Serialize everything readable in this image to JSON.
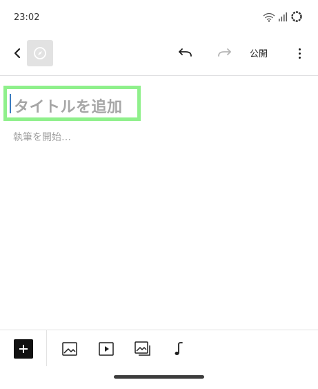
{
  "status_bar": {
    "time": "23:02",
    "icons": [
      "wifi-icon",
      "signal-icon",
      "battery-ring-icon"
    ]
  },
  "toolbar": {
    "back_icon": "chevron-left-icon",
    "site_icon": "compass-icon",
    "undo_icon": "undo-icon",
    "redo_icon": "redo-icon",
    "publish_label": "公開",
    "more_icon": "more-vertical-icon"
  },
  "editor": {
    "title_placeholder": "タイトルを追加",
    "body_placeholder": "執筆を開始…"
  },
  "block_bar": {
    "items": [
      {
        "name": "add-block-button",
        "icon": "plus-icon"
      },
      {
        "name": "image-block-button",
        "icon": "image-icon"
      },
      {
        "name": "video-block-button",
        "icon": "video-icon"
      },
      {
        "name": "gallery-block-button",
        "icon": "gallery-icon"
      },
      {
        "name": "audio-block-button",
        "icon": "music-note-icon"
      }
    ]
  },
  "colors": {
    "highlight": "#8ff08b",
    "caret": "#3a7bbf",
    "placeholder": "#a6a6a6",
    "add_button_bg": "#111111"
  }
}
